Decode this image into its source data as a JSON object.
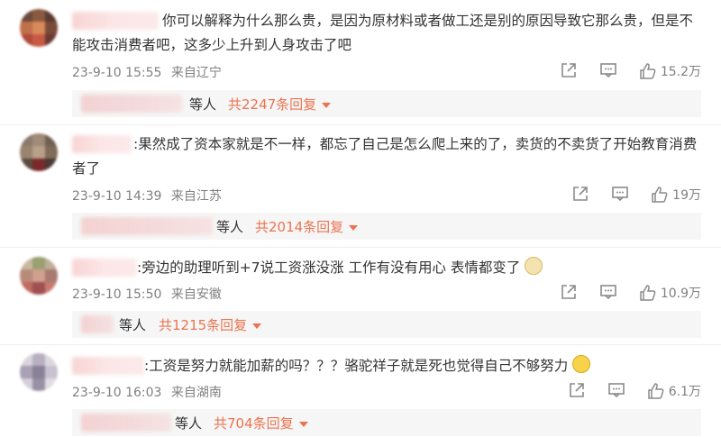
{
  "comments": [
    {
      "text": "你可以解释为什么那么贵，是因为原材料或者做工还是别的原因导致它那么贵，但是不能攻击消费者吧，这多少上升到人身攻击了吧",
      "time": "23-9-10 15:55",
      "location": "来自辽宁",
      "likes": "15.2万",
      "reply_etc": "等人",
      "reply_total": "共2247条回复"
    },
    {
      "text": ":果然成了资本家就是不一样，都忘了自己是怎么爬上来的了，卖货的不卖货了开始教育消费者了",
      "time": "23-9-10 14:39",
      "location": "来自江苏",
      "likes": "19万",
      "reply_etc": "等人",
      "reply_total": "共2014条回复"
    },
    {
      "text": ":旁边的助理听到+7说工资涨没涨 工作有没有用心 表情都变了",
      "time": "23-9-10 15:50",
      "location": "来自安徽",
      "likes": "10.9万",
      "reply_etc": "等人",
      "reply_total": "共1215条回复"
    },
    {
      "text": ":工资是努力就能加薪的吗？？？骆驼祥子就是死也觉得自己不够努力",
      "time": "23-9-10 16:03",
      "location": "来自湖南",
      "likes": "6.1万",
      "reply_etc": "等人",
      "reply_total": "共704条回复"
    }
  ],
  "icons": {
    "share": "share-icon",
    "comment": "comment-icon",
    "like": "thumbs-up-icon",
    "expand": "chevron-down-icon"
  },
  "colors": {
    "link": "#eb7350",
    "meta": "#808080",
    "reply_bg": "#f6f6f6"
  }
}
